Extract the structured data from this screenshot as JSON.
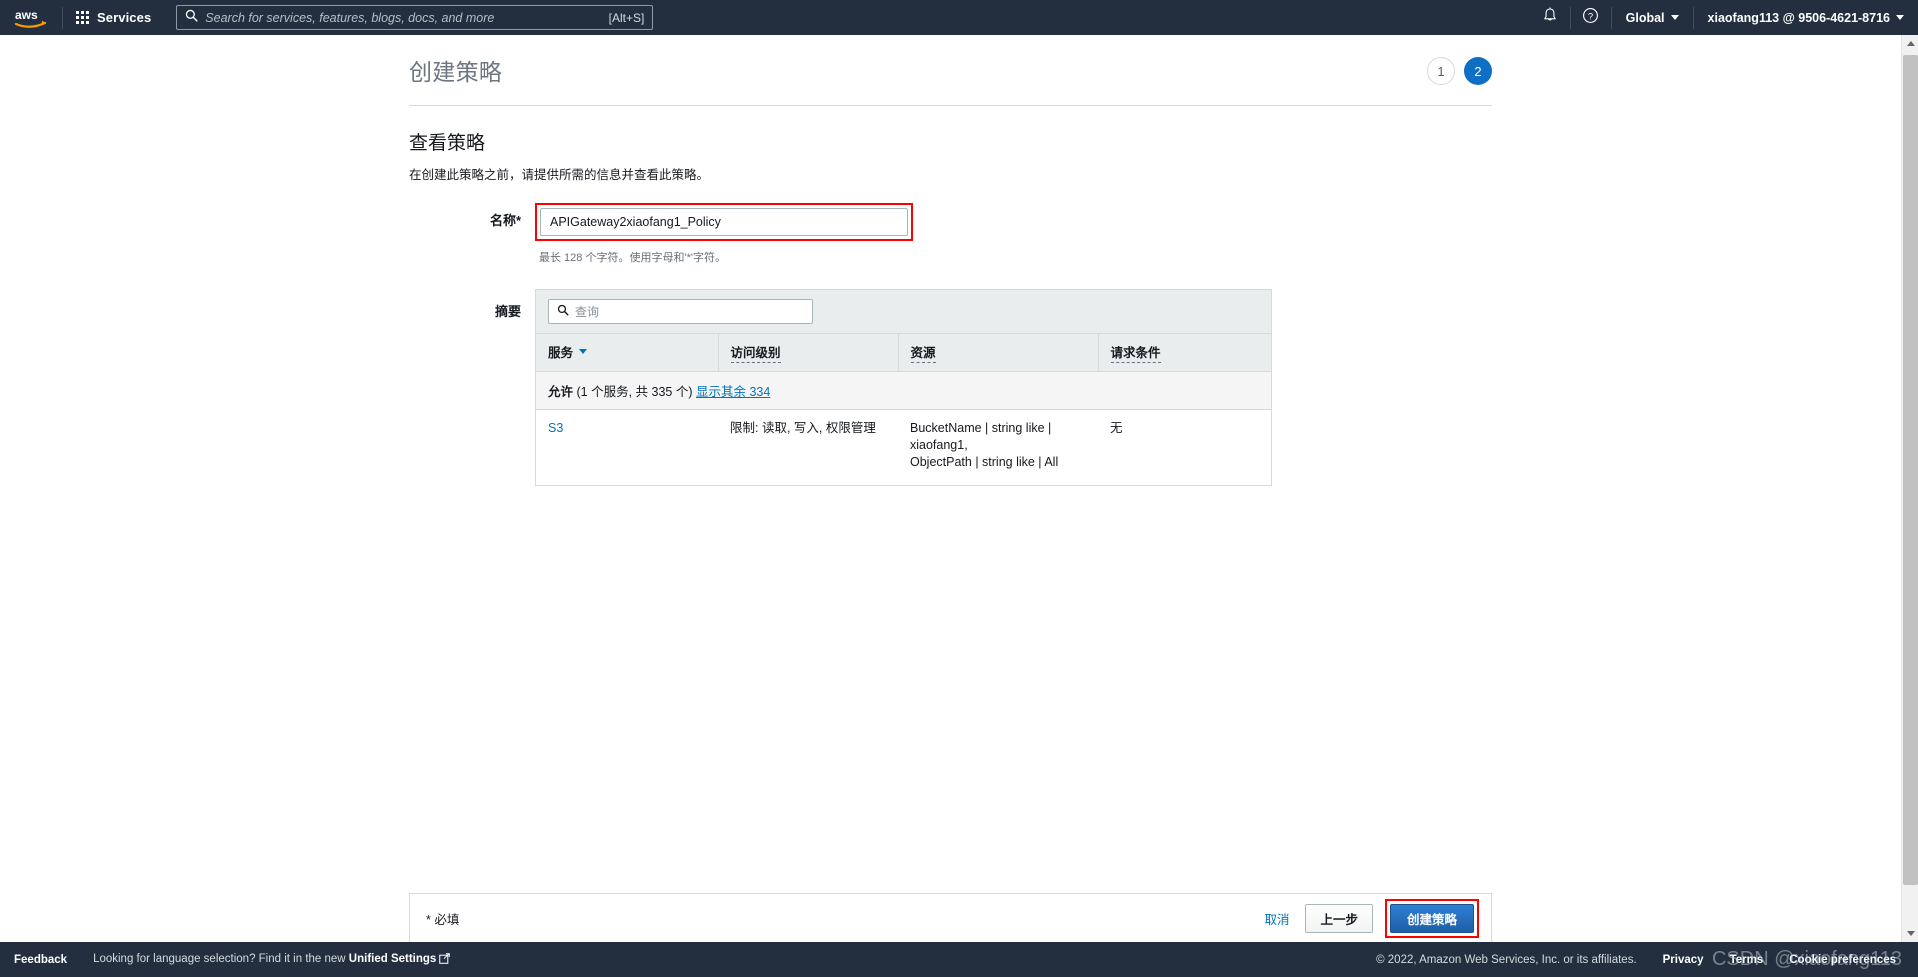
{
  "topnav": {
    "logo_alt": "aws",
    "services_label": "Services",
    "search_placeholder": "Search for services, features, blogs, docs, and more",
    "search_shortcut": "[Alt+S]",
    "bell_icon": "bell-icon",
    "help_icon": "help-circle-icon",
    "region_label": "Global",
    "account_label": "xiaofang113 @ 9506-4621-8716"
  },
  "page": {
    "title": "创建策略",
    "steps": [
      {
        "number": "1",
        "state": "inactive"
      },
      {
        "number": "2",
        "state": "active"
      }
    ],
    "section_title": "查看策略",
    "section_desc": "在创建此策略之前，请提供所需的信息并查看此策略。"
  },
  "name_field": {
    "label": "名称*",
    "value": "APIGateway2xiaofang1_Policy",
    "placeholder": "",
    "hint": "最长 128 个字符。使用字母和'*'字符。"
  },
  "summary": {
    "label": "摘要",
    "search_placeholder": "查询",
    "search_icon": "search-icon",
    "columns": [
      {
        "label": "服务",
        "sortable": true,
        "tooltip": false
      },
      {
        "label": "访问级别",
        "sortable": false,
        "tooltip": true
      },
      {
        "label": "资源",
        "sortable": false,
        "tooltip": true
      },
      {
        "label": "请求条件",
        "sortable": false,
        "tooltip": true
      }
    ],
    "group_row": {
      "prefix": "允许",
      "count_text": "(1 个服务, 共 335 个)",
      "show_more_link": "显示其余 334"
    },
    "rows": [
      {
        "service": "S3",
        "access_level": "限制: 读取, 写入, 权限管理",
        "resource_lines": [
          "BucketName | string like | xiaofang1,",
          "ObjectPath | string like | All"
        ],
        "request_condition": "无"
      }
    ]
  },
  "actionbar": {
    "required_note": "* 必填",
    "cancel_label": "取消",
    "previous_label": "上一步",
    "create_label": "创建策略"
  },
  "footer": {
    "feedback_label": "Feedback",
    "language_text_prefix": "Looking for language selection? Find it in the new ",
    "language_link": "Unified Settings",
    "external_icon": "external-link-icon",
    "copyright": "© 2022, Amazon Web Services, Inc. or its affiliates.",
    "privacy_label": "Privacy",
    "terms_label": "Terms",
    "cookie_label": "Cookie preferences"
  },
  "watermark": {
    "text": "CSDN @xiaofang113"
  },
  "colors": {
    "nav_bg": "#232f3e",
    "accent_blue": "#0073bb",
    "step_active": "#0f6fc5",
    "primary_button": "#2f7fd4",
    "highlight_red": "#ff0000"
  }
}
